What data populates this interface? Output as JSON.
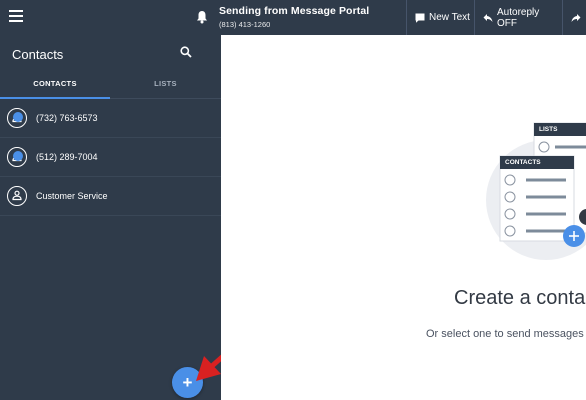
{
  "header": {
    "sending_title": "Sending from Message Portal",
    "sending_number": "(813) 413-1260",
    "new_text_label": "New Text",
    "autoreply_label": "Autoreply OFF"
  },
  "sidebar": {
    "title": "Contacts",
    "tabs": [
      {
        "label": "CONTACTS",
        "active": true
      },
      {
        "label": "LISTS",
        "active": false
      }
    ],
    "contacts": [
      {
        "name": "(732) 763-6573",
        "badge": true
      },
      {
        "name": "(512) 289-7004",
        "badge": true
      },
      {
        "name": "Customer Service",
        "badge": false
      }
    ]
  },
  "main": {
    "illustration": {
      "lists_label": "LISTS",
      "contacts_label": "CONTACTS"
    },
    "headline": "Create a conta",
    "subline": "Or select one to send messages"
  },
  "colors": {
    "dark_bg": "#2f3b4a",
    "accent": "#4a8fe7",
    "arrow": "#d92121"
  },
  "icons": {
    "menu": "hamburger-icon",
    "bell": "bell-icon",
    "search": "search-icon",
    "new_text": "message-icon",
    "autoreply": "reply-icon",
    "fab": "plus-icon"
  }
}
